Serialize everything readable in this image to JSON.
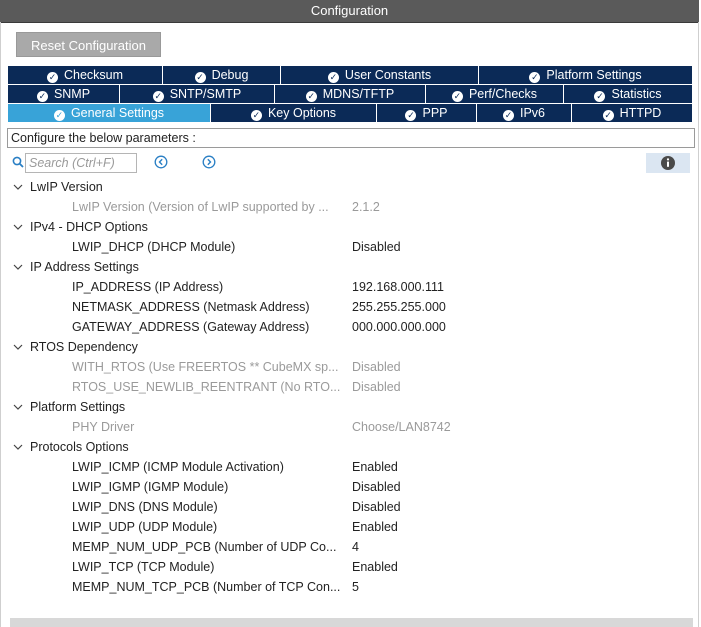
{
  "window": {
    "title": "Configuration"
  },
  "toolbar": {
    "reset_label": "Reset Configuration"
  },
  "tabs": {
    "row1": [
      {
        "label": "Checksum"
      },
      {
        "label": "Debug"
      },
      {
        "label": "User Constants"
      },
      {
        "label": "Platform Settings"
      }
    ],
    "row2": [
      {
        "label": "SNMP"
      },
      {
        "label": "SNTP/SMTP"
      },
      {
        "label": "MDNS/TFTP"
      },
      {
        "label": "Perf/Checks"
      },
      {
        "label": "Statistics"
      }
    ],
    "row3": [
      {
        "label": "General Settings",
        "active": true
      },
      {
        "label": "Key Options"
      },
      {
        "label": "PPP"
      },
      {
        "label": "IPv6"
      },
      {
        "label": "HTTPD"
      }
    ]
  },
  "configure_text": "Configure the below parameters :",
  "search": {
    "placeholder": "Search (Ctrl+F)"
  },
  "colors": {
    "tab_dark": "#0b2a57",
    "tab_active": "#38a3d8",
    "title_bar": "#5a5a5a",
    "disabled_text": "#9a9a9a"
  },
  "icons": {
    "search": "search-icon",
    "prev": "arrow-left-circle-icon",
    "next": "arrow-right-circle-icon",
    "info": "info-icon",
    "check": "check-circle-icon",
    "chevron": "chevron-down-icon"
  },
  "groups": [
    {
      "label": "LwIP Version",
      "params": [
        {
          "name": "LwIP Version (Version of LwIP supported by ...",
          "value": "2.1.2",
          "disabled": true
        }
      ]
    },
    {
      "label": "IPv4 - DHCP Options",
      "params": [
        {
          "name": "LWIP_DHCP (DHCP Module)",
          "value": "Disabled",
          "disabled": false
        }
      ]
    },
    {
      "label": "IP Address Settings",
      "params": [
        {
          "name": "IP_ADDRESS (IP Address)",
          "value": "192.168.000.111",
          "disabled": false
        },
        {
          "name": "NETMASK_ADDRESS (Netmask Address)",
          "value": "255.255.255.000",
          "disabled": false
        },
        {
          "name": "GATEWAY_ADDRESS (Gateway Address)",
          "value": "000.000.000.000",
          "disabled": false
        }
      ]
    },
    {
      "label": "RTOS Dependency",
      "params": [
        {
          "name": "WITH_RTOS (Use FREERTOS ** CubeMX sp...",
          "value": "Disabled",
          "disabled": true
        },
        {
          "name": "RTOS_USE_NEWLIB_REENTRANT (No RTO...",
          "value": "Disabled",
          "disabled": true
        }
      ]
    },
    {
      "label": "Platform Settings",
      "params": [
        {
          "name": "PHY Driver",
          "value": "Choose/LAN8742",
          "disabled": true
        }
      ]
    },
    {
      "label": "Protocols Options",
      "params": [
        {
          "name": "LWIP_ICMP (ICMP Module Activation)",
          "value": "Enabled",
          "disabled": false
        },
        {
          "name": "LWIP_IGMP (IGMP Module)",
          "value": "Disabled",
          "disabled": false
        },
        {
          "name": "LWIP_DNS (DNS Module)",
          "value": "Disabled",
          "disabled": false
        },
        {
          "name": "LWIP_UDP (UDP Module)",
          "value": "Enabled",
          "disabled": false
        },
        {
          "name": "MEMP_NUM_UDP_PCB (Number of UDP Co...",
          "value": "4",
          "disabled": false
        },
        {
          "name": "LWIP_TCP (TCP Module)",
          "value": "Enabled",
          "disabled": false
        },
        {
          "name": "MEMP_NUM_TCP_PCB (Number of TCP Con...",
          "value": "5",
          "disabled": false
        }
      ]
    }
  ]
}
